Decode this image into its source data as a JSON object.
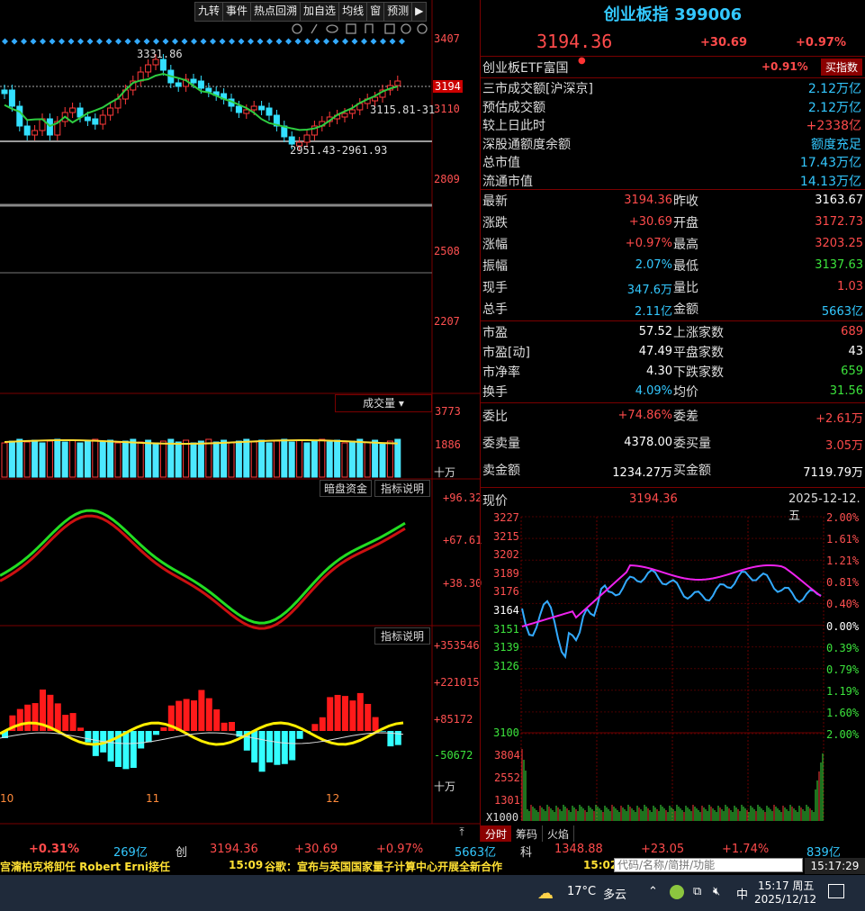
{
  "toolbar": {
    "items": [
      "九转",
      "事件",
      "热点回溯",
      "加自选",
      "均线",
      "窗",
      "预测"
    ]
  },
  "kline": {
    "y_labels": [
      "3407",
      "3110",
      "2809",
      "2508",
      "2207"
    ],
    "price_tag": "3194",
    "annot_high": "3331.86",
    "annot_mid": "3115.81-31",
    "annot_low": "2951.43-2961.93",
    "volume_label": "成交量",
    "vol_y_labels": [
      "3773",
      "1886",
      "十万"
    ],
    "dark_pool_label": "暗盘资金",
    "indicator_label": "指标说明",
    "osc_y_labels": [
      "+96.32",
      "+67.61",
      "+38.30"
    ],
    "indicator_label2": "指标说明",
    "macd_y_labels": [
      "+353546",
      "+221015",
      "+85172",
      "-50672",
      "十万"
    ],
    "x_labels": [
      "10",
      "11",
      "12"
    ]
  },
  "header": {
    "name": "创业板指",
    "code": "399006",
    "price": "3194.36",
    "change": "+30.69",
    "pct": "+0.97%"
  },
  "etf": {
    "name": "创业板ETF富国",
    "pct": "+0.91%",
    "buy_label": "买指数"
  },
  "stats1": [
    {
      "label": "三市成交额[沪深京]",
      "value": "2.12万亿",
      "color": "cyan"
    },
    {
      "label": "预估成交额",
      "value": "2.12万亿",
      "color": "cyan"
    },
    {
      "label": "较上日此时",
      "value": "+2338亿",
      "color": "red"
    },
    {
      "label": "深股通额度余额",
      "value": "额度充足",
      "color": "cyan"
    },
    {
      "label": "总市值",
      "value": "17.43万亿",
      "color": "cyan"
    },
    {
      "label": "流通市值",
      "value": "14.13万亿",
      "color": "cyan"
    }
  ],
  "quote": [
    {
      "l1": "最新",
      "v1": "3194.36",
      "c1": "red",
      "l2": "昨收",
      "v2": "3163.67",
      "c2": "white"
    },
    {
      "l1": "涨跌",
      "v1": "+30.69",
      "c1": "red",
      "l2": "开盘",
      "v2": "3172.73",
      "c2": "red"
    },
    {
      "l1": "涨幅",
      "v1": "+0.97%",
      "c1": "red",
      "l2": "最高",
      "v2": "3203.25",
      "c2": "red"
    },
    {
      "l1": "振幅",
      "v1": "2.07%",
      "c1": "cyan",
      "l2": "最低",
      "v2": "3137.63",
      "c2": "green"
    },
    {
      "l1": "现手",
      "v1": "347.6万",
      "c1": "cyan",
      "l2": "量比",
      "v2": "1.03",
      "c2": "red"
    },
    {
      "l1": "总手",
      "v1": "2.11亿",
      "c1": "cyan",
      "l2": "金额",
      "v2": "5663亿",
      "c2": "cyan"
    }
  ],
  "breadth": [
    {
      "l1": "市盈",
      "v1": "57.52",
      "c1": "white",
      "l2": "上涨家数",
      "v2": "689",
      "c2": "red"
    },
    {
      "l1": "市盈[动]",
      "v1": "47.49",
      "c1": "white",
      "l2": "平盘家数",
      "v2": "43",
      "c2": "white"
    },
    {
      "l1": "市净率",
      "v1": "4.30",
      "c1": "white",
      "l2": "下跌家数",
      "v2": "659",
      "c2": "green"
    },
    {
      "l1": "换手",
      "v1": "4.09%",
      "c1": "cyan",
      "l2": "均价",
      "v2": "31.56",
      "c2": "green"
    }
  ],
  "order": [
    {
      "l1": "委比",
      "v1": "+74.86%",
      "c1": "red",
      "l2": "委差",
      "v2": "+2.61万",
      "c2": "red"
    },
    {
      "l1": "委卖量",
      "v1": "4378.00",
      "c1": "white",
      "l2": "委买量",
      "v2": "3.05万",
      "c2": "red"
    },
    {
      "l1": "卖金额",
      "v1": "1234.27万",
      "c1": "white",
      "l2": "买金额",
      "v2": "7119.79万",
      "c2": "white"
    }
  ],
  "intraday": {
    "label": "现价",
    "price": "3194.36",
    "date": "2025-12-12.五",
    "left_labels": [
      "3227",
      "3215",
      "3202",
      "3189",
      "3176",
      "3164",
      "3151",
      "3139",
      "3126",
      "3100"
    ],
    "right_labels": [
      "2.00%",
      "1.61%",
      "1.21%",
      "0.81%",
      "0.40%",
      "0.00%",
      "0.39%",
      "0.79%",
      "1.19%",
      "1.60%",
      "2.00%"
    ],
    "vol_labels": [
      "3804",
      "2552",
      "1301",
      "X1000"
    ],
    "tabs": [
      "分时",
      "筹码",
      "火焰"
    ]
  },
  "tickbar": {
    "pct1": "+0.31%",
    "amt1": "269亿",
    "name2": "创",
    "price2": "3194.36",
    "chg2": "+30.69",
    "pct2": "+0.97%",
    "amt2": "5663亿",
    "name3": "科",
    "price3": "1348.88",
    "chg3": "+23.05",
    "pct3": "+1.74%",
    "amt3": "839亿"
  },
  "news": {
    "item1": "宫澝柏克将卸任 Robert Erni接任",
    "time2": "15:09",
    "item2": "谷歌：宣布与英国国家量子计算中心开展全新合作",
    "time3": "15:02",
    "search_placeholder": "代码/名称/简拼/功能",
    "clock": "15:17:29"
  },
  "taskbar": {
    "temp": "17°C",
    "weather": "多云",
    "ime": "中",
    "time": "15:17 周五",
    "date": "2025/12/12"
  },
  "chart_data": [
    {
      "type": "line",
      "title": "现价",
      "series": [],
      "x": [],
      "ylim": [
        3100,
        3227
      ],
      "grid": true
    }
  ]
}
